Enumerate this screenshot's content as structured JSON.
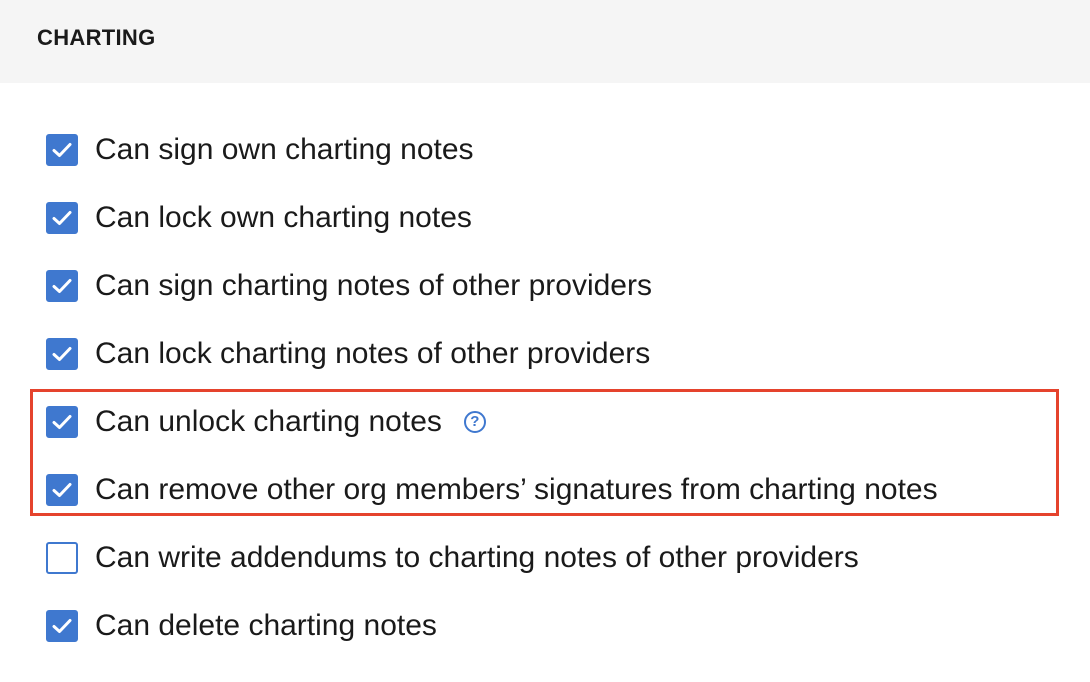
{
  "section": {
    "title": "CHARTING"
  },
  "permissions": [
    {
      "label": "Can sign own charting notes",
      "checked": true
    },
    {
      "label": "Can lock own charting notes",
      "checked": true
    },
    {
      "label": "Can sign charting notes of other providers",
      "checked": true
    },
    {
      "label": "Can lock charting notes of other providers",
      "checked": true
    },
    {
      "label": "Can unlock charting notes",
      "checked": true,
      "help": "?"
    },
    {
      "label": "Can remove other org members’ signatures from charting notes",
      "checked": true
    },
    {
      "label": "Can write addendums to charting notes of other providers",
      "checked": false
    },
    {
      "label": "Can delete charting notes",
      "checked": true
    }
  ],
  "colors": {
    "checkbox": "#3f78cf",
    "highlight": "#e5432d",
    "header_bg": "#f5f5f5"
  },
  "icons": {
    "check": "checkmark-icon",
    "help": "question-circle-icon"
  }
}
